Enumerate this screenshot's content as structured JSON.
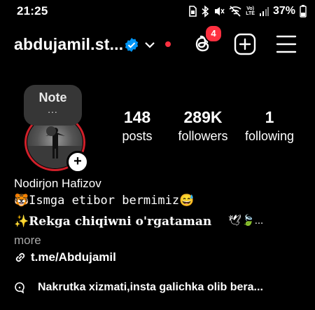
{
  "status_bar": {
    "time": "21:25",
    "network_top": "Vo)",
    "network_bottom": "LTE",
    "battery": "37%"
  },
  "header": {
    "username": "abdujamil.st...",
    "threads_badge": "4"
  },
  "profile": {
    "note_label": "Note",
    "note_dots": "...",
    "add_story": "+",
    "stats": [
      {
        "value": "148",
        "label": "posts"
      },
      {
        "value": "289K",
        "label": "followers"
      },
      {
        "value": "1",
        "label": "following"
      }
    ],
    "full_name": "Nodirjon Hafizov",
    "bio_line1": "🐯Ismga etibor bermimiz😅",
    "bio_line2": "✨Rekga chiqiwni o'rgataman",
    "bio_line2_emoji": "🕊🍃...",
    "more": "more",
    "link": "t.me/Abdujamil",
    "thread_text": "Nakrutka xizmati,insta galichka olib bera..."
  },
  "colors": {
    "background": "#000000",
    "accent_red": "#ff3040",
    "verified_blue": "#0095f6",
    "muted": "#a8a8a8"
  }
}
